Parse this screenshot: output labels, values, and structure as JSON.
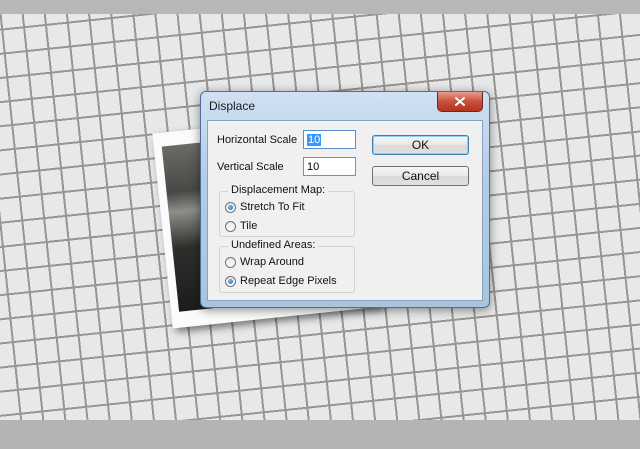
{
  "dialog": {
    "title": "Displace",
    "close_icon": "close-x-icon",
    "horizontal_scale": {
      "label": "Horizontal Scale",
      "value": "10"
    },
    "vertical_scale": {
      "label": "Vertical Scale",
      "value": "10"
    },
    "displacement_map": {
      "label": "Displacement Map:",
      "options": [
        {
          "label": "Stretch To Fit",
          "selected": true
        },
        {
          "label": "Tile",
          "selected": false
        }
      ]
    },
    "undefined_areas": {
      "label": "Undefined Areas:",
      "options": [
        {
          "label": "Wrap Around",
          "selected": false
        },
        {
          "label": "Repeat Edge Pixels",
          "selected": true
        }
      ]
    },
    "ok_label": "OK",
    "cancel_label": "Cancel"
  },
  "colors": {
    "title_bar": "#b3cde6",
    "close_button": "#c8513c",
    "radio_selected": "#1d5aa8"
  }
}
